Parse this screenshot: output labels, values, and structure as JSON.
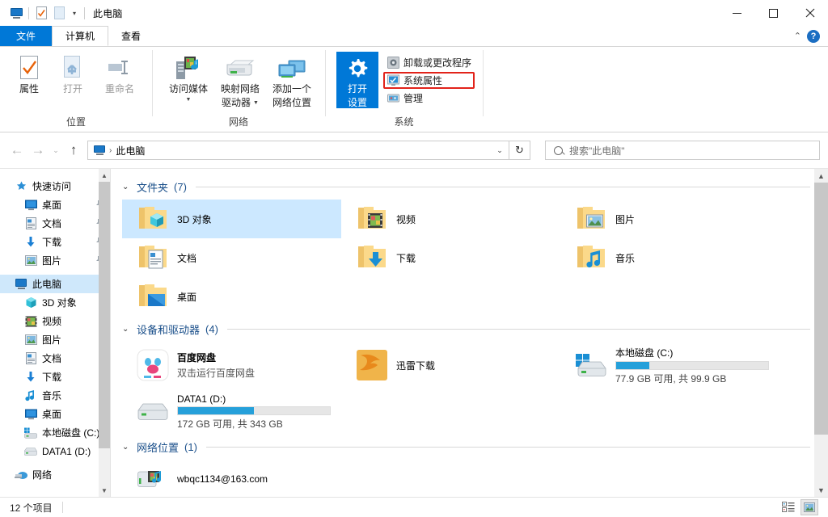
{
  "window": {
    "title": "此电脑",
    "quick_access": [
      "pc-icon",
      "properties-icon",
      "new-folder-icon"
    ],
    "caret": "▾",
    "minimize": "—",
    "maximize": "▢",
    "close": "✕"
  },
  "tabs": {
    "file": "文件",
    "computer": "计算机",
    "view": "查看",
    "collapse_ribbon": "⌃",
    "help": "?"
  },
  "ribbon": {
    "groups": [
      {
        "label": "位置",
        "buttons": [
          {
            "label": "属性",
            "icon": "properties-icon",
            "disabled": false
          },
          {
            "label": "打开",
            "icon": "open-icon",
            "disabled": true
          },
          {
            "label": "重命名",
            "icon": "rename-icon",
            "disabled": true
          }
        ]
      },
      {
        "label": "网络",
        "buttons": [
          {
            "label": "访问媒体",
            "icon": "access-media-icon",
            "dropdown": true
          },
          {
            "label": "映射网络\n驱动器",
            "line1": "映射网络",
            "line2": "驱动器",
            "icon": "map-network-drive-icon",
            "dropdown": true
          },
          {
            "label": "添加一个\n网络位置",
            "line1": "添加一个",
            "line2": "网络位置",
            "icon": "add-network-location-icon",
            "dropdown": false
          }
        ]
      },
      {
        "label": "系统",
        "big": {
          "line1": "打开",
          "line2": "设置",
          "icon": "settings-gear-icon"
        },
        "small": [
          {
            "label": "卸载或更改程序",
            "icon": "uninstall-program-icon",
            "highlighted": false
          },
          {
            "label": "系统属性",
            "icon": "system-properties-icon",
            "highlighted": true
          },
          {
            "label": "管理",
            "icon": "manage-icon",
            "highlighted": false
          }
        ]
      }
    ]
  },
  "address": {
    "back": "←",
    "forward": "→",
    "recent": "⌄",
    "up": "↑",
    "crumb_icon": "pc-icon",
    "crumb_separator": "›",
    "crumb_text": "此电脑",
    "dropdown": "⌄",
    "refresh": "↻",
    "search_placeholder": "搜索\"此电脑\"",
    "search_value": "",
    "search_icon": "search-icon"
  },
  "sidebar": {
    "items": [
      {
        "label": "快速访问",
        "icon": "star-pin-icon",
        "level": 0,
        "pinned": false,
        "selected": false
      },
      {
        "label": "桌面",
        "icon": "desktop-icon",
        "level": 1,
        "pinned": true,
        "selected": false
      },
      {
        "label": "文档",
        "icon": "documents-icon",
        "level": 1,
        "pinned": true,
        "selected": false
      },
      {
        "label": "下载",
        "icon": "downloads-icon",
        "level": 1,
        "pinned": true,
        "selected": false
      },
      {
        "label": "图片",
        "icon": "pictures-icon",
        "level": 1,
        "pinned": true,
        "selected": false
      },
      {
        "label": "此电脑",
        "icon": "pc-icon",
        "level": 0,
        "pinned": false,
        "selected": true
      },
      {
        "label": "3D 对象",
        "icon": "3d-objects-icon",
        "level": 1,
        "pinned": false,
        "selected": false
      },
      {
        "label": "视频",
        "icon": "videos-icon",
        "level": 1,
        "pinned": false,
        "selected": false
      },
      {
        "label": "图片",
        "icon": "pictures-icon",
        "level": 1,
        "pinned": false,
        "selected": false
      },
      {
        "label": "文档",
        "icon": "documents-icon",
        "level": 1,
        "pinned": false,
        "selected": false
      },
      {
        "label": "下载",
        "icon": "downloads-icon",
        "level": 1,
        "pinned": false,
        "selected": false
      },
      {
        "label": "音乐",
        "icon": "music-icon",
        "level": 1,
        "pinned": false,
        "selected": false
      },
      {
        "label": "桌面",
        "icon": "desktop-icon",
        "level": 1,
        "pinned": false,
        "selected": false
      },
      {
        "label": "本地磁盘 (C:)",
        "icon": "windows-drive-icon",
        "level": 1,
        "pinned": false,
        "selected": false
      },
      {
        "label": "DATA1 (D:)",
        "icon": "drive-icon",
        "level": 1,
        "pinned": false,
        "selected": false
      },
      {
        "label": "网络",
        "icon": "network-icon",
        "level": 0,
        "pinned": false,
        "selected": false
      }
    ]
  },
  "content": {
    "groups": [
      {
        "name": "文件夹",
        "count": "(7)",
        "chevron": "⌄",
        "items": [
          {
            "name": "3D 对象",
            "icon": "folder-3d-objects-icon",
            "selected": true
          },
          {
            "name": "视频",
            "icon": "folder-videos-icon",
            "selected": false
          },
          {
            "name": "图片",
            "icon": "folder-pictures-icon",
            "selected": false
          },
          {
            "name": "文档",
            "icon": "folder-documents-icon",
            "selected": false
          },
          {
            "name": "下载",
            "icon": "folder-downloads-icon",
            "selected": false
          },
          {
            "name": "音乐",
            "icon": "folder-music-icon",
            "selected": false
          },
          {
            "name": "桌面",
            "icon": "folder-desktop-icon",
            "selected": false
          }
        ]
      },
      {
        "name": "设备和驱动器",
        "count": "(4)",
        "chevron": "⌄",
        "items": [
          {
            "name": "百度网盘",
            "sub": "双击运行百度网盘",
            "icon": "baidu-netdisk-icon",
            "kind": "app"
          },
          {
            "name": "迅雷下载",
            "sub": "",
            "icon": "thunder-download-icon",
            "kind": "app"
          },
          {
            "name": "本地磁盘 (C:)",
            "free_text": "77.9 GB 可用, 共 99.9 GB",
            "icon": "windows-drive-icon",
            "kind": "drive",
            "used_percent": 22
          },
          {
            "name": "DATA1 (D:)",
            "free_text": "172 GB 可用, 共 343 GB",
            "icon": "drive-icon",
            "kind": "drive",
            "used_percent": 50
          }
        ]
      },
      {
        "name": "网络位置",
        "count": "(1)",
        "chevron": "⌄",
        "items": [
          {
            "name": "wbqc1134@163.com",
            "icon": "network-media-icon",
            "kind": "netloc"
          }
        ]
      }
    ]
  },
  "status": {
    "item_count": "12 个项目",
    "view_details_icon": "details-view-icon",
    "view_large_icons_icon": "large-icons-view-icon",
    "active_view": "large-icons-view-icon"
  },
  "colors": {
    "accent": "#0078d7",
    "file_tab": "#0078d7",
    "group_header": "#1a4f8a",
    "selection": "#cce8ff",
    "highlight_box": "#e2231a",
    "drive_bar": "#26a0da"
  }
}
